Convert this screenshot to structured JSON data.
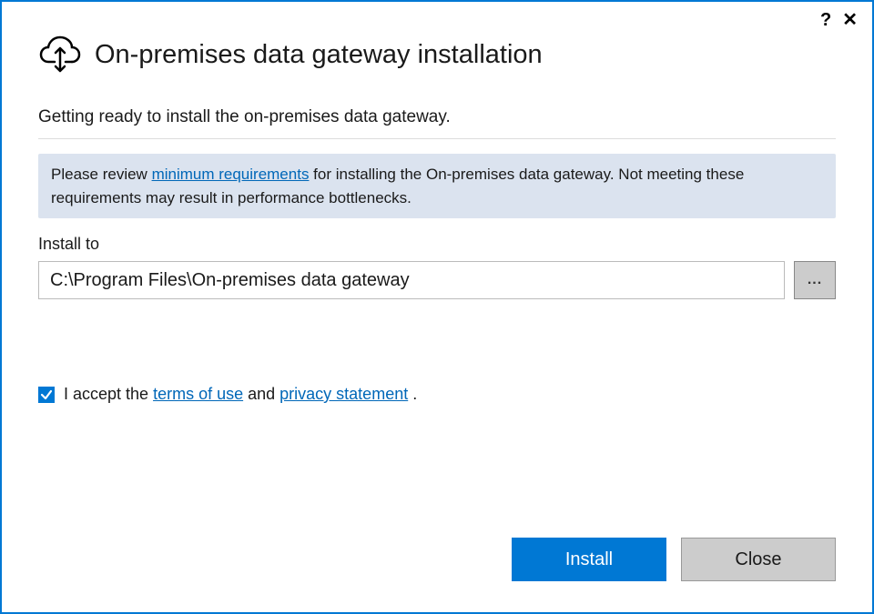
{
  "header": {
    "title": "On-premises data gateway installation"
  },
  "subtitle": "Getting ready to install the on-premises data gateway.",
  "info": {
    "prefix": "Please review ",
    "link": "minimum requirements",
    "suffix": " for installing the On-premises data gateway. Not meeting these requirements may result in performance bottlenecks."
  },
  "install": {
    "label": "Install to",
    "path": "C:\\Program Files\\On-premises data gateway",
    "browse": "..."
  },
  "accept": {
    "prefix": "I accept the ",
    "terms": "terms of use",
    "middle": " and ",
    "privacy": "privacy statement",
    "suffix": " .",
    "checked": true
  },
  "buttons": {
    "install": "Install",
    "close": "Close"
  },
  "titlebar": {
    "help": "?",
    "close": "✕"
  }
}
